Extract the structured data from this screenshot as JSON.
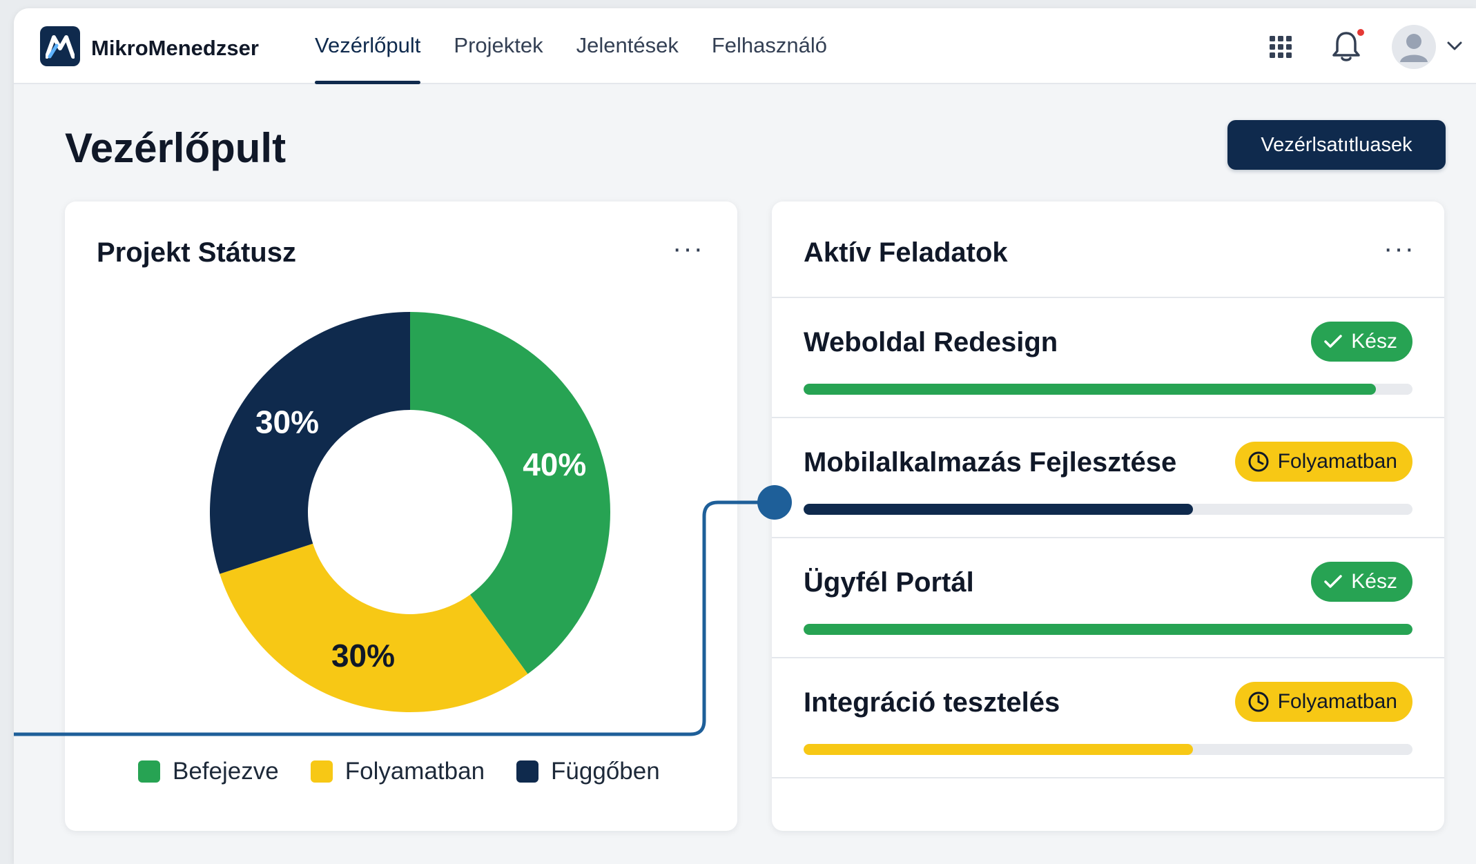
{
  "header": {
    "app_name": "MikroMenedzser",
    "nav": [
      {
        "label": "Vezérlőpult",
        "active": true
      },
      {
        "label": "Projektek",
        "active": false
      },
      {
        "label": "Jelentések",
        "active": false
      },
      {
        "label": "Felhasználó",
        "active": false
      }
    ],
    "icons": [
      "apps-grid-icon",
      "bell-icon",
      "avatar",
      "chevron-down-icon"
    ],
    "notification_dot_color": "#e53935"
  },
  "page": {
    "title": "Vezérlőpult",
    "action_button": "Vezérlsatıtluasek"
  },
  "status_card": {
    "title": "Projekt Státusz",
    "more_label": "···"
  },
  "chart_data": {
    "type": "pie",
    "donut": true,
    "categories": [
      "Befejezve",
      "Folyamatban",
      "Függőben"
    ],
    "values": [
      40,
      30,
      30
    ],
    "labels": [
      "40%",
      "30%",
      "30%"
    ],
    "colors": [
      "#27a353",
      "#f7c815",
      "#0f2a4d"
    ],
    "legend_position": "bottom"
  },
  "tasks_card": {
    "title": "Aktív Feladatok",
    "more_label": "···",
    "items": [
      {
        "name": "Weboldal Redesign",
        "status": "Kész",
        "status_type": "done",
        "progress": 0.94,
        "bar_color": "#27a353"
      },
      {
        "name": "Mobilalkalmazás Fejlesztése",
        "status": "Folyamatban",
        "status_type": "progress",
        "progress": 0.64,
        "bar_color": "#0f2a4d"
      },
      {
        "name": "Ügyfél Portál",
        "status": "Kész",
        "status_type": "done",
        "progress": 1.0,
        "bar_color": "#27a353"
      },
      {
        "name": "Integráció tesztelés",
        "status": "Folyamatban",
        "status_type": "progress",
        "progress": 0.64,
        "bar_color": "#f7c815"
      }
    ]
  },
  "colors": {
    "accent": "#0f2a4d",
    "done": "#27a353",
    "in_progress": "#f7c815",
    "connector": "#1e5f99"
  }
}
